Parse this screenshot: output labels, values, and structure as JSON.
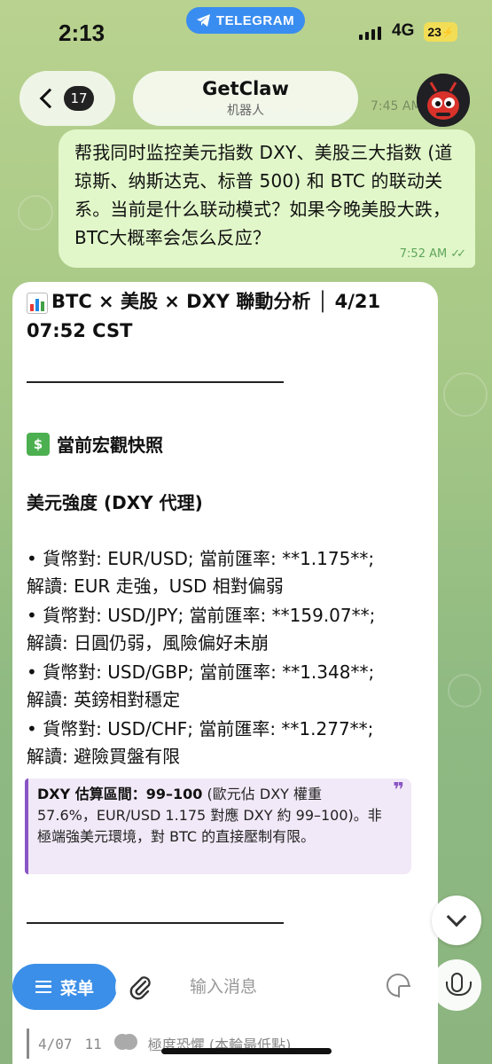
{
  "status_bar": {
    "time": "2:13",
    "app_pill": "TELEGRAM",
    "network": "4G",
    "battery": "23"
  },
  "header": {
    "back_count": "17",
    "chat_name": "GetClaw",
    "chat_subtitle": "机器人",
    "behind_time": "7:45 AM"
  },
  "outgoing": {
    "text": "帮我同时监控美元指数 DXY、美股三大指数 (道琼斯、纳斯达克、标普 500) 和 BTC 的联动关系。当前是什么联动模式？如果今晚美股大跌，BTC大概率会怎么反应？",
    "time": "7:52 AM"
  },
  "incoming": {
    "title": "BTC × 美股 × DXY 聯動分析 │ 4/21 07:52 CST",
    "divider_text": "________________________",
    "section_macro": "當前宏觀快照",
    "dxy_heading": "美元強度 (DXY 代理)",
    "lines": [
      "• 貨幣對: EUR/USD; 當前匯率: **1.175**;",
      "解讀: EUR 走強，USD 相對偏弱",
      "• 貨幣對: USD/JPY; 當前匯率: **159.07**;",
      "解讀: 日圓仍弱，風險偏好未崩",
      "• 貨幣對: USD/GBP; 當前匯率: **1.348**;",
      "解讀: 英鎊相對穩定",
      "• 貨幣對: USD/CHF; 當前匯率: **1.277**;",
      "解讀: 避險買盤有限"
    ],
    "quote_bold": "DXY 估算區間：99–100",
    "quote_rest": " (歐元佔 DXY 權重 57.6%，EUR/USD 1.175 對應 DXY 約 99–100)。非極端強美元環境，對 BTC 的直接壓制有限。",
    "peek_date": "4/07",
    "peek_num": "11",
    "peek_text": "極度恐懼 (本輪最低點)"
  },
  "bottom_bar": {
    "menu_label": "菜单",
    "input_placeholder": "输入消息"
  },
  "colors": {
    "menu_button": "#3b8fe8",
    "outgoing_bubble": "#e1f7c9",
    "quote_accent": "#8a55c4"
  },
  "icons": [
    "telegram-icon",
    "back-chevron-icon",
    "bot-avatar",
    "chart-emoji-icon",
    "currency-exchange-emoji-icon",
    "quote-icon",
    "chevron-down-icon",
    "hamburger-icon",
    "paperclip-icon",
    "sticker-icon",
    "microphone-icon"
  ]
}
